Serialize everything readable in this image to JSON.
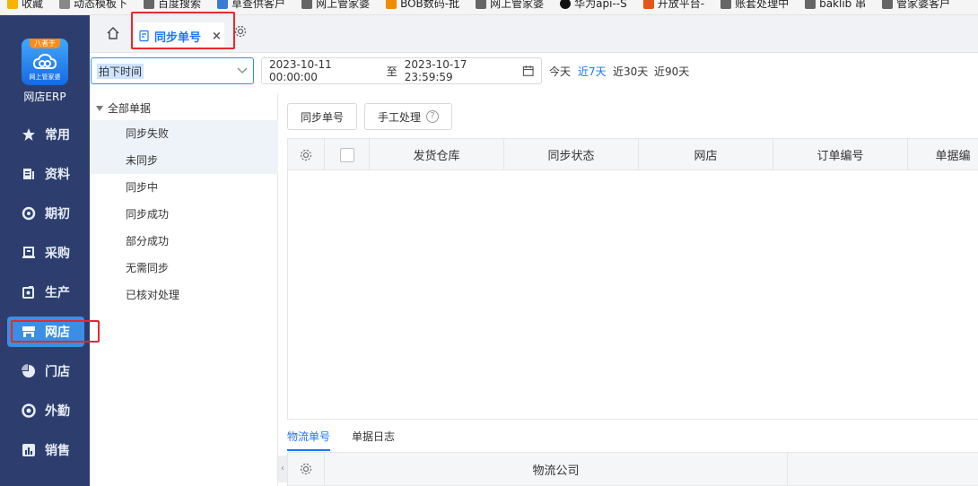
{
  "bookmarks": [
    {
      "label": "收藏",
      "color": "#f5b400"
    },
    {
      "label": "动态模板下",
      "color": "#888888"
    },
    {
      "label": "百度搜索",
      "color": "#666666"
    },
    {
      "label": "草查供客户",
      "color": "#3a7bd5"
    },
    {
      "label": "网上管家婆",
      "color": "#666666"
    },
    {
      "label": "BOB数码-批",
      "color": "#f08c00"
    },
    {
      "label": "网上管家婆",
      "color": "#666666"
    },
    {
      "label": "华为api--S",
      "color": "#111111"
    },
    {
      "label": "开放平台-",
      "color": "#e2561b"
    },
    {
      "label": "账套处理中",
      "color": "#666666"
    },
    {
      "label": "baklib 串",
      "color": "#666666"
    },
    {
      "label": "管家婆客户",
      "color": "#666666"
    }
  ],
  "logo": {
    "tag": "八者于",
    "subtitle": "网上管家婆",
    "title": "网店ERP"
  },
  "nav": [
    {
      "label": "常用",
      "icon": "star-icon"
    },
    {
      "label": "资料",
      "icon": "document-icon"
    },
    {
      "label": "期初",
      "icon": "cycle-icon"
    },
    {
      "label": "采购",
      "icon": "purchase-icon"
    },
    {
      "label": "生产",
      "icon": "production-icon"
    },
    {
      "label": "网店",
      "icon": "store-icon"
    },
    {
      "label": "门店",
      "icon": "pie-icon"
    },
    {
      "label": "外勤",
      "icon": "field-icon"
    },
    {
      "label": "销售",
      "icon": "chart-icon"
    }
  ],
  "tabs": {
    "active_label": "同步单号",
    "close": "×"
  },
  "filter": {
    "select_value": "拍下时间",
    "date_from": "2023-10-11 00:00:00",
    "date_sep": "至",
    "date_to": "2023-10-17 23:59:59",
    "quick": [
      "今天",
      "近7天",
      "近30天",
      "近90天"
    ],
    "quick_active": "近7天"
  },
  "tree": {
    "root": "全部单据",
    "items": [
      "同步失败",
      "未同步",
      "同步中",
      "同步成功",
      "部分成功",
      "无需同步",
      "已核对处理"
    ]
  },
  "toolbar": {
    "sync_label": "同步单号",
    "manual_label": "手工处理",
    "help": "?"
  },
  "grid": {
    "columns": [
      "发货仓库",
      "同步状态",
      "网店",
      "订单编号",
      "单据编"
    ]
  },
  "bottom_tabs": {
    "tabs": [
      "物流单号",
      "单据日志"
    ],
    "active": "物流单号",
    "column": "物流公司"
  },
  "colors": {
    "sidebar": "#2d3e6e",
    "accent": "#1677ff",
    "highlight": "#e8282b"
  }
}
